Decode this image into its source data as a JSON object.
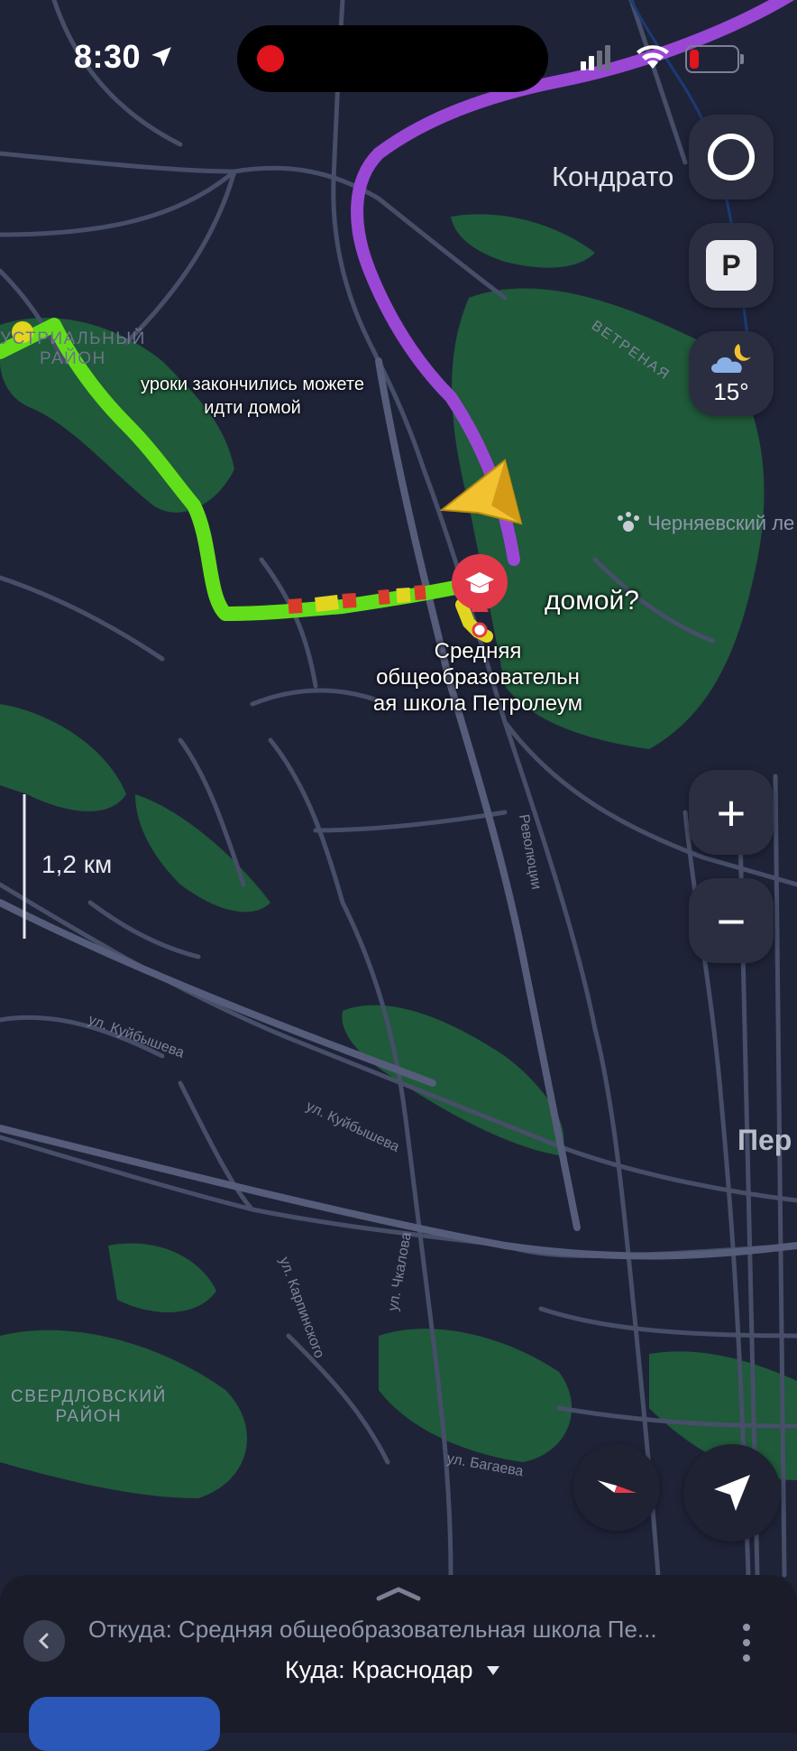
{
  "status_bar": {
    "time": "8:30"
  },
  "map": {
    "place_labels": {
      "kondratovo": "Кондрато",
      "chernyaevsky": "Черняевский ле",
      "perm": "Пер",
      "sverdlovsky": "СВЕРДЛОВСКИЙ\nРАЙОН",
      "industrialny": "УСТРИАЛЬНЫЙ\nРАЙОН"
    },
    "street_labels": {
      "vetrennaya": "ВЕТРЕНАЯ",
      "kuybysheva1": "ул. Куйбышева",
      "kuybysheva2": "ул. Куйбышева",
      "chkalova": "ул. Чкалова",
      "bagaeva": "ул. Багаева",
      "karpinskogo": "ул. Карпинского",
      "revolyutsii": "Революции"
    },
    "annotation_main": "уроки закончились можете\nидти домой",
    "annotation_home": "домой?",
    "poi_name": "Средняя\nобщеобразовательн\nая школа Петролеум",
    "scale_label": "1,2 км"
  },
  "controls": {
    "alice_icon": "alice-assistant-icon",
    "parking_label": "P",
    "weather_temp": "15°",
    "zoom_in": "+",
    "zoom_out": "−"
  },
  "route_panel": {
    "from": "Откуда: Средняя общеобразовательная школа Пе...",
    "to": "Куда: Краснодар"
  },
  "colors": {
    "map_bg": "#1f2338",
    "forest": "#1f5a3a",
    "road": "#464e68",
    "route_purple": "#9a47d6",
    "route_green": "#62df1a",
    "poi_red": "#e23a4a"
  }
}
